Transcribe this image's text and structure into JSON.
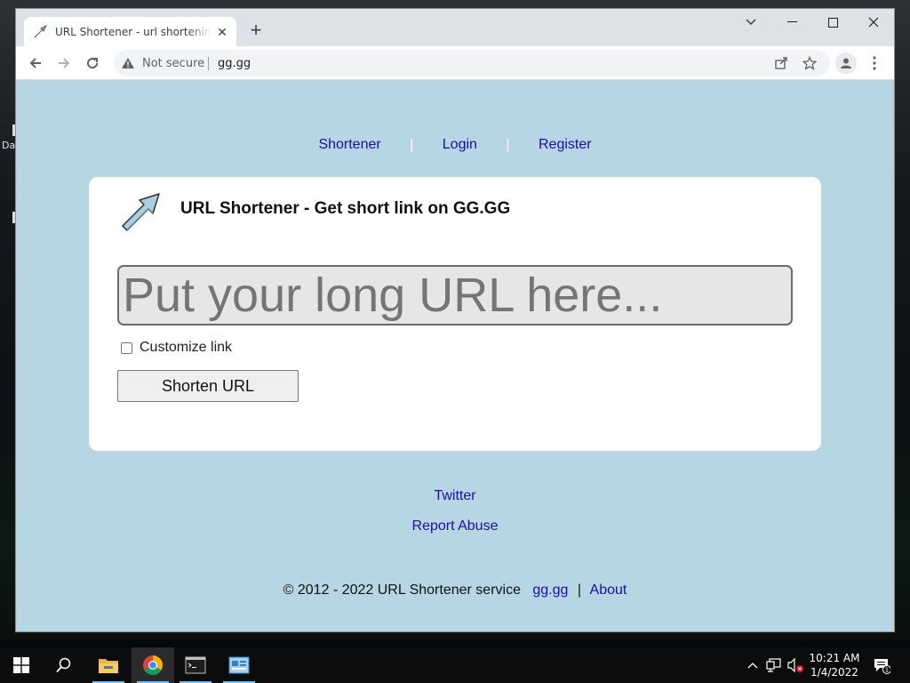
{
  "browser": {
    "tab_title": "URL Shortener - url shortening service",
    "secure_label": "Not secure",
    "url": "gg.gg"
  },
  "nav": {
    "shortener": "Shortener",
    "separator": "|",
    "login": "Login",
    "register": "Register"
  },
  "card": {
    "title": "URL Shortener - Get short link on GG.GG",
    "url_input_placeholder": "Put your long URL here...",
    "customize_label": "Customize link",
    "customize_checked": false,
    "shorten_button": "Shorten URL"
  },
  "footer": {
    "twitter": "Twitter",
    "report_abuse": "Report Abuse",
    "copyright": "© 2012 - 2022 URL Shortener service",
    "site_link": "gg.gg",
    "pipe": "|",
    "about": "About"
  },
  "desktop": {
    "icon_label": "Da"
  },
  "taskbar": {
    "time": "10:21 AM",
    "date": "1/4/2022",
    "notification_count": "1",
    "items": [
      "start-icon",
      "search-icon",
      "file-explorer-icon",
      "chrome-icon",
      "terminal-icon",
      "control-panel-icon"
    ]
  },
  "colors": {
    "page_background": "#b7d6e4",
    "link": "#1a0dab",
    "card_background": "#ffffff"
  }
}
